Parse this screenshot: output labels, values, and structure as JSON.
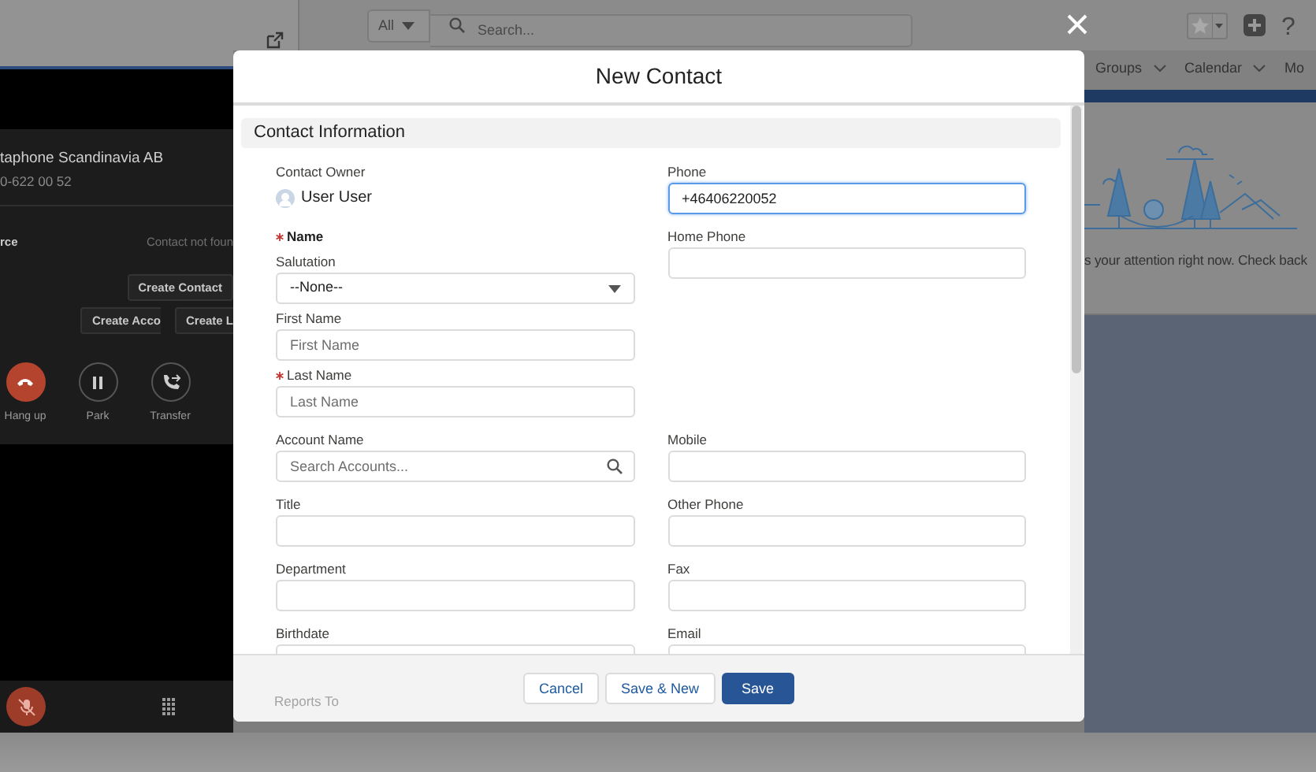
{
  "topbar": {
    "search_scope": "All",
    "search_placeholder": "Search...",
    "help": "?"
  },
  "softphone": {
    "caller": "taphone Scandinavia AB",
    "number": "0-622 00 52",
    "source_label": "rce",
    "contact_status": "Contact not foun",
    "actions": [
      "Create Contact",
      "Create Acco",
      "Create L"
    ],
    "controls": [
      {
        "label": "Hang up",
        "kind": "hangup"
      },
      {
        "label": "Park",
        "kind": "park"
      },
      {
        "label": "Transfer",
        "kind": "transfer"
      }
    ]
  },
  "nav": [
    {
      "label": "Groups",
      "menu": true
    },
    {
      "label": "Calendar",
      "menu": true
    },
    {
      "label": "Mo",
      "menu": false
    }
  ],
  "empty_state": {
    "message": "s your attention right now. Check back"
  },
  "modal": {
    "title": "New Contact",
    "section": "Contact Information",
    "rows": [
      {
        "left": {
          "kind": "owner",
          "label": "Contact Owner",
          "value": "User User",
          "required": false
        },
        "right": {
          "kind": "text",
          "label": "Phone",
          "value": "+46406220052",
          "required": false,
          "focused": true
        }
      },
      {
        "left": {
          "kind": "group",
          "label": "Name",
          "required": true,
          "fields": [
            {
              "kind": "select",
              "label": "Salutation",
              "value": "--None--",
              "required": false
            },
            {
              "kind": "text",
              "label": "First Name",
              "placeholder": "First Name",
              "required": false,
              "focused": false
            },
            {
              "kind": "text",
              "label": "Last Name",
              "placeholder": "Last Name",
              "required": true,
              "focused": false
            }
          ]
        },
        "right": {
          "kind": "text",
          "label": "Home Phone",
          "required": false,
          "focused": false
        }
      },
      {
        "left": {
          "kind": "lookup",
          "label": "Account Name",
          "placeholder": "Search Accounts...",
          "required": false
        },
        "right": {
          "kind": "text",
          "label": "Mobile",
          "required": false,
          "focused": false
        }
      },
      {
        "left": {
          "kind": "text",
          "label": "Title",
          "required": false,
          "focused": false
        },
        "right": {
          "kind": "text",
          "label": "Other Phone",
          "required": false,
          "focused": false
        }
      },
      {
        "left": {
          "kind": "text",
          "label": "Department",
          "required": false,
          "focused": false
        },
        "right": {
          "kind": "text",
          "label": "Fax",
          "required": false,
          "focused": false
        }
      },
      {
        "left": {
          "kind": "date",
          "label": "Birthdate",
          "required": false
        },
        "right": {
          "kind": "text",
          "label": "Email",
          "required": false,
          "focused": false
        }
      }
    ],
    "footer_hint": "Reports To",
    "buttons": [
      {
        "label": "Cancel",
        "kind": "neutral"
      },
      {
        "label": "Save & New",
        "kind": "neutral"
      },
      {
        "label": "Save",
        "kind": "brand"
      }
    ]
  }
}
